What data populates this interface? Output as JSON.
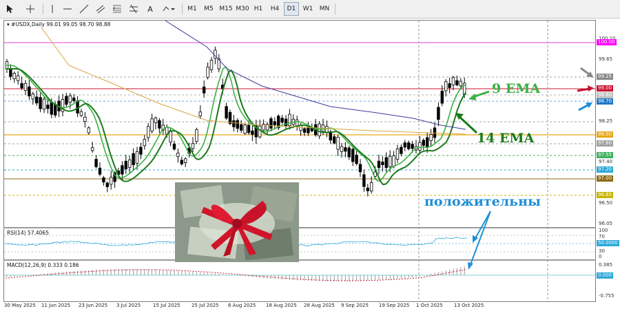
{
  "toolbar": {
    "timeframes": [
      "M1",
      "M5",
      "M15",
      "M30",
      "H1",
      "H4",
      "D1",
      "W1",
      "MN"
    ],
    "active_timeframe": "D1",
    "text_tool_label": "A"
  },
  "chart": {
    "header": "#USDX,Daily  99.01 99.05 98.70 98.88",
    "symbol": "#USDX",
    "period": "Daily",
    "ohlc": {
      "open": 99.01,
      "high": 99.05,
      "low": 98.7,
      "close": 98.88
    }
  },
  "price_scale": {
    "labels": [
      "100.10",
      "99.65",
      "99.25",
      "98.70",
      "98.25",
      "97.80",
      "97.40",
      "96.95",
      "96.50",
      "96.05"
    ],
    "highlighted": [
      {
        "value": "100.00",
        "color": "#ff00ff"
      },
      {
        "value": "99.25",
        "color": "#888888"
      },
      {
        "value": "99.00",
        "color": "#c8102e"
      },
      {
        "value": "98.80",
        "color": "#c0c0c0"
      },
      {
        "value": "98.70",
        "color": "#1f77c8"
      },
      {
        "value": "98.00",
        "color": "#e6a817"
      },
      {
        "value": "97.80",
        "color": "#a0a0a0"
      },
      {
        "value": "97.55",
        "color": "#40b060"
      },
      {
        "value": "97.20",
        "color": "#2aa7d8"
      },
      {
        "value": "97.00",
        "color": "#8b6914"
      },
      {
        "value": "96.65",
        "color": "#c8b400"
      }
    ]
  },
  "rsi": {
    "label": "RSI(14) 57.4065",
    "scale": [
      "100",
      "70",
      "50.0000",
      "30",
      "0"
    ]
  },
  "macd": {
    "label": "MACD(12,26,9) 0.333 0.186",
    "scale": [
      "0.385",
      "0.000",
      "-0.755"
    ]
  },
  "dates": [
    "30 May 2025",
    "11 Jun 2025",
    "23 Jun 2025",
    "3 Jul 2025",
    "15 Jul 2025",
    "25 Jul 2025",
    "6 Aug 2025",
    "18 Aug 2025",
    "28 Aug 2025",
    "9 Sep 2025",
    "19 Sep 2025",
    "1 Oct 2025",
    "13 Oct 2025"
  ],
  "annotations": {
    "ema9": "9 EMA",
    "ema14": "14 EMA",
    "positive": "положительны"
  },
  "colors": {
    "ema9": "#3cb043",
    "ema14": "#1b7a1b",
    "ma_slow": "#3b3b9a",
    "ma_mid": "#d9a441",
    "annotation_blue": "#1f8fd6",
    "bull": "#ffffff",
    "bear": "#000000"
  }
}
